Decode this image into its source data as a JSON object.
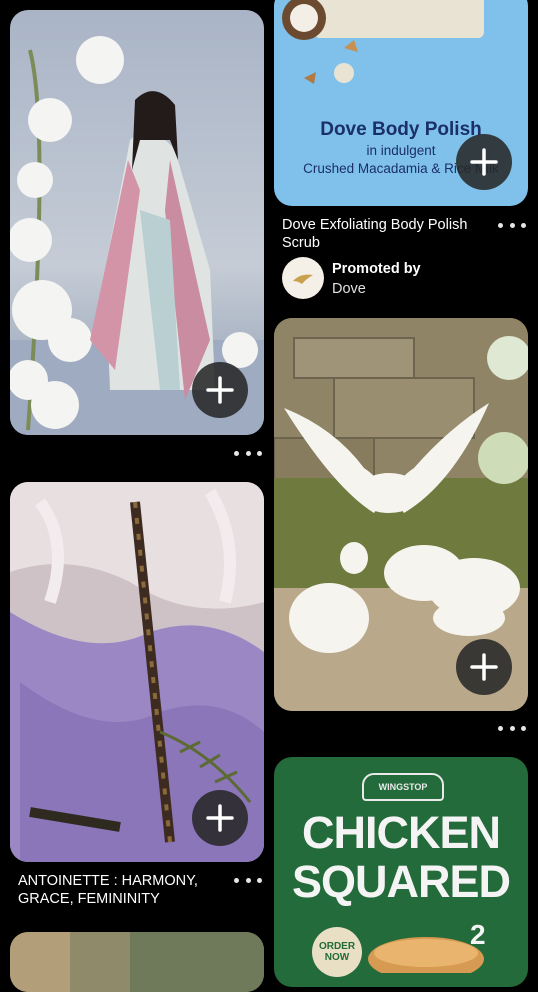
{
  "pins": {
    "woman_lilies": {
      "image_icon": "painting-woman-lilies-image"
    },
    "dove_ad": {
      "ad_headline": "Dove Body Polish",
      "ad_subline1": "in indulgent",
      "ad_subline2": "Crushed Macadamia & Rice Milk",
      "title": "Dove Exfoliating Body Polish Scrub",
      "promoted_label": "Promoted by",
      "advertiser": "Dove"
    },
    "antoinette": {
      "title": "ANTOINETTE : HARMONY, GRACE, FEMININITY"
    },
    "doves_painting": {
      "image_icon": "painting-white-doves-image"
    },
    "wingstop_ad": {
      "brand": "WINGSTOP",
      "headline_line1": "CHICKEN",
      "headline_line2": "SQUARED",
      "order_label_line1": "ORDER",
      "order_label_line2": "NOW",
      "badge_number": "2"
    }
  },
  "colors": {
    "background": "#000000",
    "dove_blue": "#7fc1ea",
    "dove_navy": "#1a2f6b",
    "wingstop_green": "#236b3a",
    "button_dark": "#282828"
  }
}
